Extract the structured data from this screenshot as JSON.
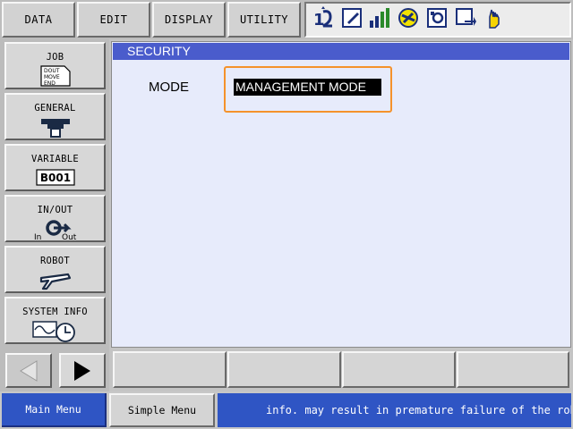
{
  "top_menu": {
    "data_label": "DATA",
    "edit_label": "EDIT",
    "display_label": "DISPLAY",
    "utility_label": "UTILITY"
  },
  "status_icons": [
    "axis-group-icon",
    "edit-mode-icon",
    "signal-level-icon",
    "security-mode-icon",
    "program-icon",
    "cycle-icon",
    "servo-hand-icon"
  ],
  "sidebar": {
    "job": {
      "label": "JOB",
      "icon_lines": [
        "DOUT",
        "MOVE",
        "END"
      ]
    },
    "general": {
      "label": "GENERAL"
    },
    "variable": {
      "label": "VARIABLE",
      "icon_text": "B001"
    },
    "in_out": {
      "label": "IN/OUT",
      "icon_in": "In",
      "icon_out": "Out"
    },
    "robot": {
      "label": "ROBOT"
    },
    "system_info": {
      "label": "SYSTEM INFO"
    }
  },
  "main": {
    "title": "SECURITY",
    "mode_label": "MODE",
    "mode_value": "MANAGEMENT MODE"
  },
  "bottom": {
    "main_menu_label": "Main Menu",
    "simple_menu_label": "Simple Menu",
    "message": "info. may result in premature failure of the rob"
  },
  "colors": {
    "title_bar": "#4a5ccc",
    "content_bg": "#e7ebfb",
    "highlight": "#f5922b",
    "bottom_blue": "#2f55c4"
  }
}
